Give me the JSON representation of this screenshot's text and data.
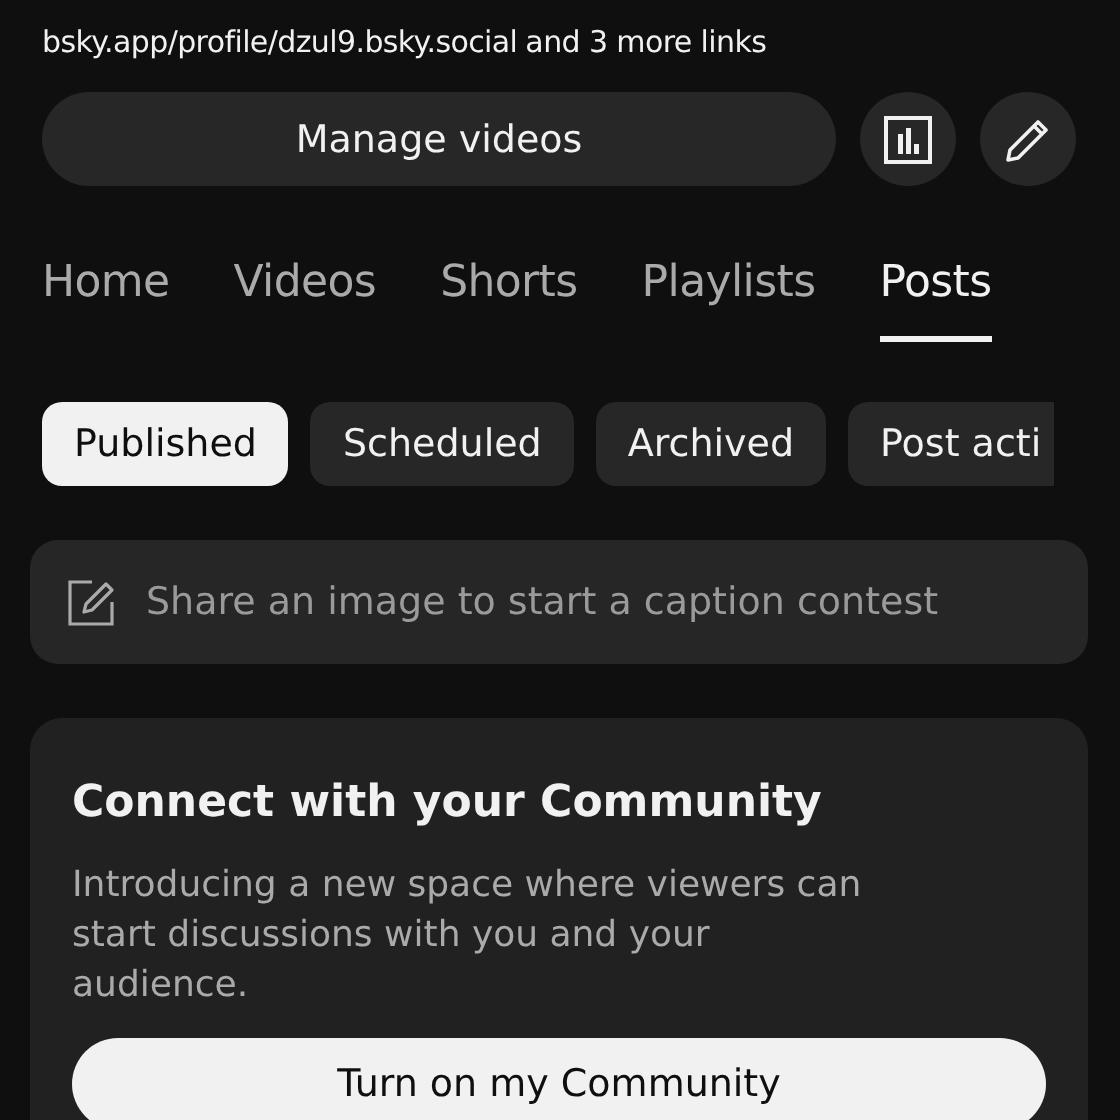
{
  "links": {
    "link": "bsky.app/profile/dzul9.bsky.social",
    "more": "and 3 more links"
  },
  "manage_button": "Manage videos",
  "tabs": [
    {
      "label": "Home",
      "selected": false
    },
    {
      "label": "Videos",
      "selected": false
    },
    {
      "label": "Shorts",
      "selected": false
    },
    {
      "label": "Playlists",
      "selected": false
    },
    {
      "label": "Posts",
      "selected": true
    }
  ],
  "chips": [
    {
      "label": "Published",
      "selected": true
    },
    {
      "label": "Scheduled",
      "selected": false
    },
    {
      "label": "Archived",
      "selected": false
    },
    {
      "label": "Post acti",
      "selected": false
    }
  ],
  "post_field": {
    "placeholder": "Share an image to start a caption contest"
  },
  "community_card": {
    "title": "Connect with your Community",
    "body": "Introducing a new space where viewers can start discussions with you and your audience.",
    "button": "Turn on my Community"
  }
}
